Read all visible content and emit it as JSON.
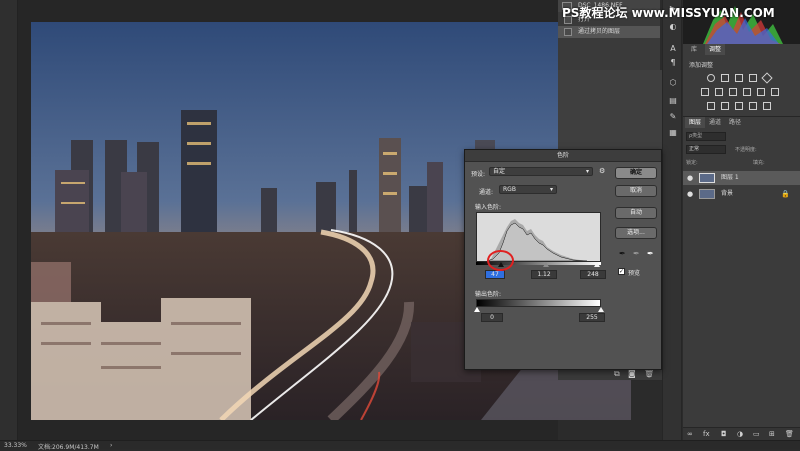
{
  "history": {
    "filename": "DSC_1486.NEF",
    "items": [
      "打开",
      "通过拷贝的图层"
    ]
  },
  "watermark": "PS教程论坛 www.MISSYUAN.COM",
  "adjust_panel": {
    "tabs": [
      "库",
      "调整"
    ],
    "title": "添加调整"
  },
  "layers_panel": {
    "tabs": [
      "图层",
      "通道",
      "路径"
    ],
    "search_placeholder": "ρ类型",
    "blend_mode": "正常",
    "opacity_label": "不透明度:",
    "lock_label": "锁定:",
    "fill_label": "填充:",
    "layers": [
      {
        "name": "图层 1"
      },
      {
        "name": "背景"
      }
    ]
  },
  "levels_dialog": {
    "title": "色阶",
    "preset_label": "预设:",
    "preset_value": "自定",
    "channel_label": "通道:",
    "channel_value": "RGB",
    "input_levels_label": "输入色阶:",
    "output_levels_label": "输出色阶:",
    "input_black": "47",
    "input_gamma": "1.12",
    "input_white": "248",
    "output_black": "0",
    "output_white": "255",
    "buttons": {
      "ok": "确定",
      "cancel": "取消",
      "auto": "自动",
      "options": "选项..."
    },
    "preview_label": "预览",
    "preview_checked": true
  },
  "statusbar": {
    "zoom": "33.33%",
    "doc_info": "文档:206.9M/413.7M"
  },
  "colors": {
    "highlight_circle": "#e02020",
    "dialog_bg": "#525252"
  }
}
